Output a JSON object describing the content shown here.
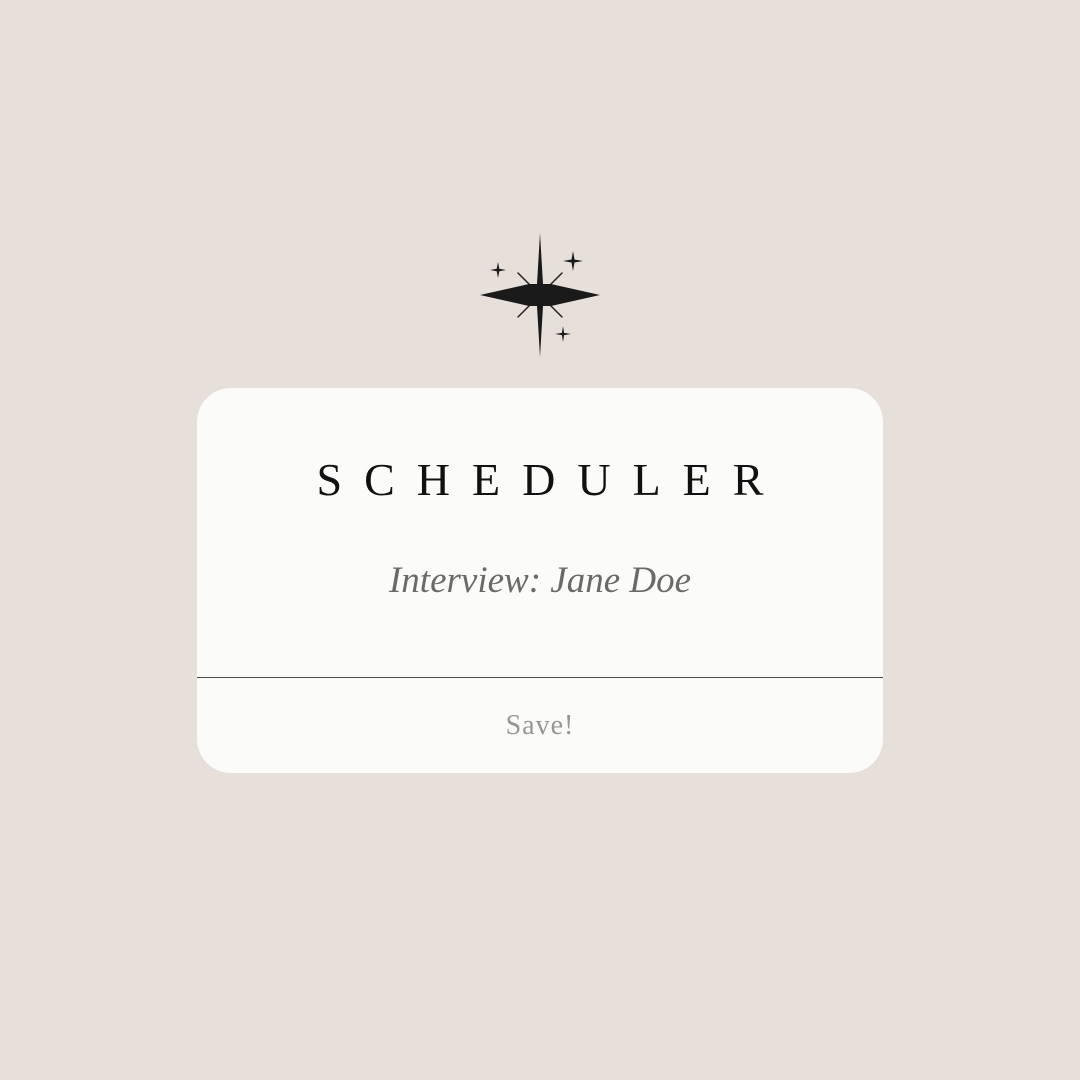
{
  "sparkle": {
    "icon": "four-point-sparkle-icon",
    "color": "#1a1a1a"
  },
  "card": {
    "title": "SCHEDULER",
    "subtitle": "Interview: Jane Doe",
    "save_label": "Save!"
  },
  "colors": {
    "background": "#e7dfda",
    "card": "#fbfbf9",
    "title": "#111111",
    "subtitle": "#6c6a67",
    "button_text": "#979694",
    "divider": "#4d4d4d"
  }
}
